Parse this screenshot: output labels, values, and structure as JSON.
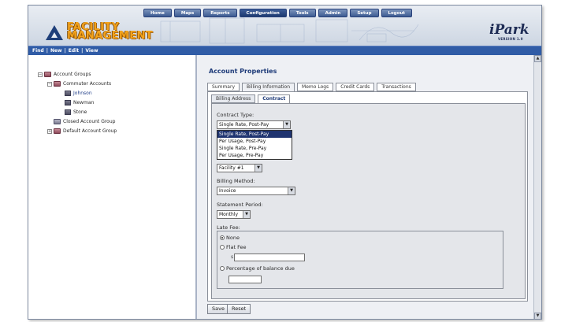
{
  "nav": {
    "menu": [
      "Home",
      "Maps",
      "Reports",
      "Configuration",
      "Tools",
      "Admin",
      "Setup",
      "Logout"
    ],
    "active_menu": "Configuration"
  },
  "brand": {
    "line1": "FACILITY",
    "line2": "MANAGEMENT",
    "product": "iPark",
    "version": "VERSION 1.0"
  },
  "toolbar": {
    "find": "Find",
    "sep": "|",
    "new": "New",
    "edit": "Edit",
    "view": "View"
  },
  "tree": {
    "root": "Account Groups",
    "commuter": "Commuter Accounts",
    "johnson": "Johnson",
    "newman": "Newman",
    "stone": "Stone",
    "closed": "Closed Account Group",
    "default": "Default Account Group"
  },
  "panel": {
    "title": "Account Properties",
    "tabs": [
      "Summary",
      "Billing Information",
      "Memo Logs",
      "Credit Cards",
      "Transactions"
    ],
    "subtabs": [
      "Billing Address",
      "Contract"
    ]
  },
  "form": {
    "contract_type_label": "Contract Type:",
    "contract_type_value": "Single Rate, Post-Pay",
    "contract_options": [
      "Single Rate, Post-Pay",
      "Per Usage, Post-Pay",
      "Single Rate, Pre-Pay",
      "Per Usage, Pre-Pay"
    ],
    "facility_value": "Facility #1",
    "billing_method_label": "Billing Method:",
    "billing_method_value": "Invoice",
    "statement_period_label": "Statement Period:",
    "statement_period_value": "Monthly",
    "late_fee_label": "Late Fee:",
    "late_none": "None",
    "late_flat": "Flat Fee",
    "late_pct": "Percentage of balance due",
    "dollar": "$"
  },
  "buttons": {
    "save": "Save",
    "reset": "Reset"
  },
  "colors": {
    "accent": "#1d3a78",
    "toolbar": "#305ca6",
    "logo": "#f2a21c"
  }
}
